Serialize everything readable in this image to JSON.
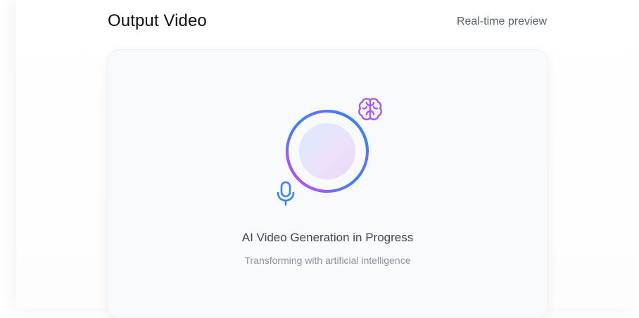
{
  "header": {
    "title": "Output Video",
    "subtitle": "Real-time preview"
  },
  "preview": {
    "status_title": "AI Video Generation in Progress",
    "status_subtitle": "Transforming with artificial intelligence",
    "icons": [
      "brain-icon",
      "microphone-icon"
    ]
  },
  "colors": {
    "ring_blue": "#3b82f6",
    "ring_purple": "#a855f7",
    "brain_icon": "#a855f7",
    "mic_icon": "#3b82f6",
    "card_bg": "#f8fafc"
  }
}
